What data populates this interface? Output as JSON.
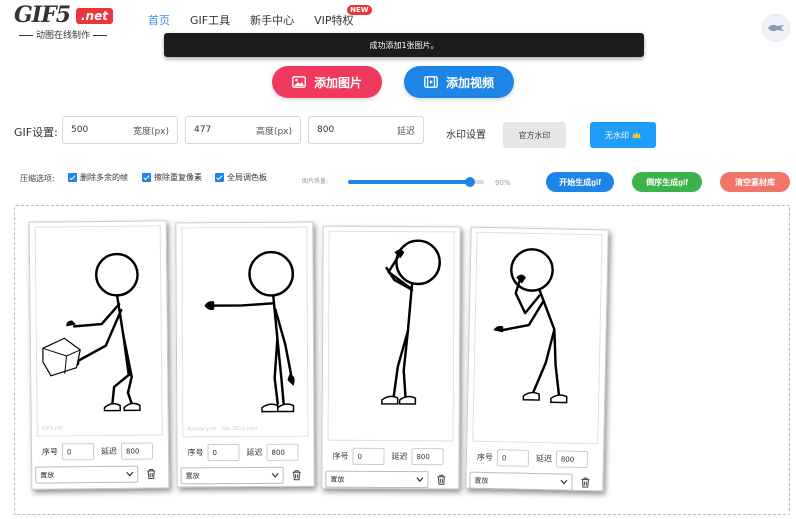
{
  "logo": {
    "text": "GIF5",
    "badge": ".net",
    "subtitle": "动图在线制作"
  },
  "nav": [
    {
      "label": "首页",
      "active": true
    },
    {
      "label": "GIF工具"
    },
    {
      "label": "新手中心"
    },
    {
      "label": "VIP特权",
      "badge": "NEW"
    }
  ],
  "toast": "成功添加1张图片。",
  "buttons": {
    "add_image": "添加图片",
    "add_video": "添加视频"
  },
  "settings": {
    "label": "GIF设置:",
    "width": {
      "value": "500",
      "unit": "宽度(px)"
    },
    "height": {
      "value": "477",
      "unit": "高度(px)"
    },
    "delay": {
      "value": "800",
      "unit": "延迟"
    }
  },
  "watermark": {
    "label": "水印设置",
    "official": "官方水印",
    "none": "无水印"
  },
  "compress": {
    "label": "压缩选项:",
    "options": [
      "删除多余的帧",
      "擦除重复像素",
      "全局调色板"
    ],
    "quality_label": "图片质量:",
    "quality_value": "90%",
    "quality_fraction": 0.9
  },
  "actions": {
    "start": "开始生成gif",
    "reverse": "倒序生成gif",
    "clear": "清空素材库"
  },
  "frame_labels": {
    "index": "序号",
    "delay": "延迟",
    "placement": "置放"
  },
  "frames": [
    {
      "index": "0",
      "delay": "800",
      "placement": "置放",
      "watermark": "GIF5.net"
    },
    {
      "index": "0",
      "delay": "800",
      "placement": "置放",
      "watermark": "Bynnacycle · 3du.2013.com"
    },
    {
      "index": "0",
      "delay": "800",
      "placement": "置放",
      "watermark": ""
    },
    {
      "index": "0",
      "delay": "800",
      "placement": "置放",
      "watermark": ""
    }
  ],
  "colors": {
    "accent": "#1e85e8",
    "pink": "#ef3a5d",
    "green": "#3cb24a",
    "salmon": "#f0766a",
    "toast_bg": "#1c1c1c"
  }
}
